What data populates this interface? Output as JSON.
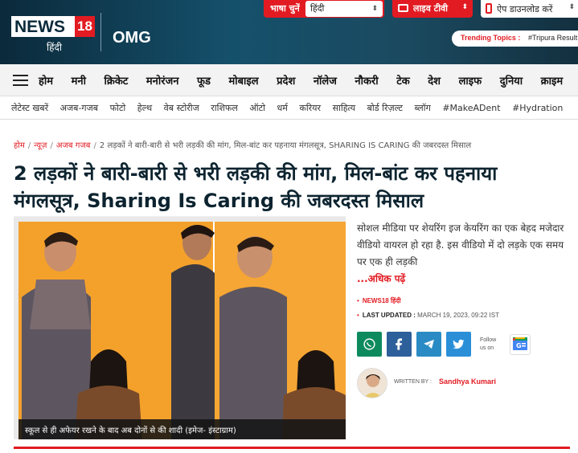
{
  "brand": {
    "logo_main": "NEWS",
    "logo_number": "18",
    "logo_sub": "हिंदी",
    "section": "OMG",
    "accent_color": "#e21b22",
    "header_color": "#15506b"
  },
  "topbar": {
    "language_label": "भाषा चुनें",
    "language_value": "हिंदी",
    "live_tv_label": "लाइव टीवी",
    "app_download_label": "ऐप डाउनलोड करें"
  },
  "trending": {
    "label": "Trending Topics :",
    "value": "#Tripura Result"
  },
  "main_nav": [
    "होम",
    "मनी",
    "क्रिकेट",
    "मनोरंजन",
    "फूड",
    "मोबाइल",
    "प्रदेश",
    "नॉलेज",
    "नौकरी",
    "टेक",
    "देश",
    "लाइफ",
    "दुनिया",
    "क्राइम"
  ],
  "sub_nav": [
    "लेटेस्ट खबरें",
    "अजब-गजब",
    "फोटो",
    "हेल्थ",
    "वेब स्टोरीज",
    "राशिफल",
    "ऑटो",
    "धर्म",
    "करियर",
    "साहित्य",
    "बोर्ड रिज़ल्ट",
    "ब्लॉग",
    "#MakeADent",
    "#Hydration"
  ],
  "breadcrumb": {
    "items": [
      "होम",
      "न्यूज़",
      "अजब गजब"
    ],
    "current": "2 लड़कों ने बारी-बारी से भरी लड़की की मांग, मिल-बांट कर पहनाया मंगलसूत्र, SHARING IS CARING की जबरदस्त मिसाल"
  },
  "article": {
    "headline": "2 लड़कों ने बारी-बारी से भरी लड़की की मांग, मिल-बांट कर पहनाया मंगलसूत्र, Sharing Is Caring की जबरदस्त मिसाल",
    "image_caption": "स्कूल से ही अफेयर रखने के बाद अब दोनों से की शादी (इमेज- इंस्टाग्राम)",
    "summary": "सोशल मीडिया पर शेयरिंग इज केयरिंग का एक बेहद मजेदार वीडियो वायरल हो रहा है. इस वीडियो में दो लड़के एक समय पर एक ही लड़की",
    "read_more": "...अधिक पढ़ें",
    "source": "NEWS18 हिंदी",
    "last_updated_label": "LAST UPDATED :",
    "last_updated_value": "MARCH 19, 2023, 09:22 IST",
    "follow_label_1": "Follow",
    "follow_label_2": "us on",
    "written_by_label": "WRITTEN BY :",
    "author": "Sandhya Kumari"
  },
  "share": {
    "whatsapp_color": "#0e8a5f",
    "facebook_color": "#2d5f9a",
    "telegram_color": "#2a8bc4",
    "twitter_color": "#2b8fd8"
  }
}
